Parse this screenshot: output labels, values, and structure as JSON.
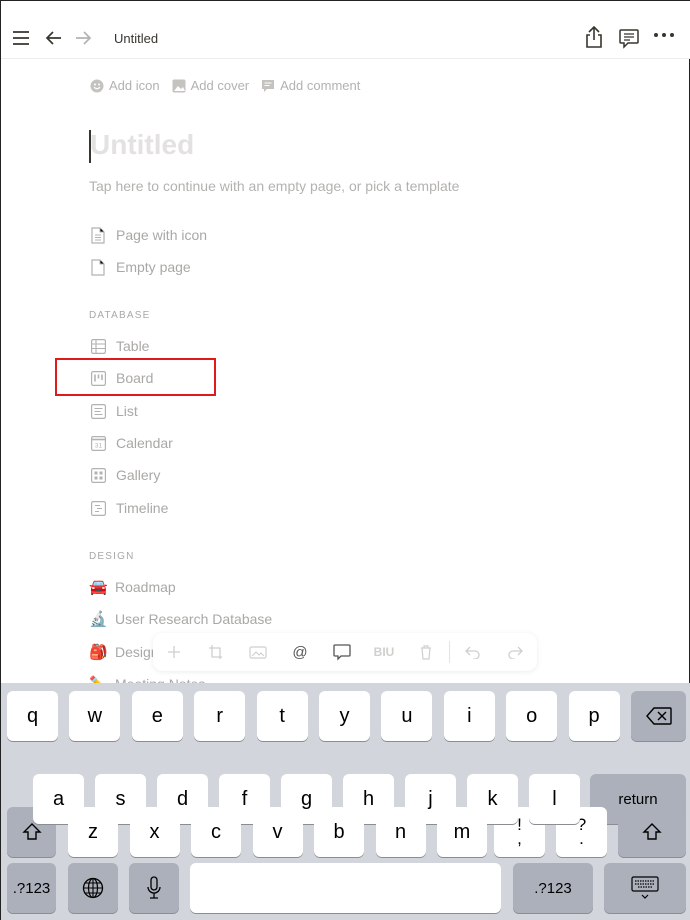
{
  "topbar": {
    "title": "Untitled",
    "icons": [
      "menu-icon",
      "back-arrow-icon",
      "forward-arrow-icon",
      "share-icon",
      "comments-icon",
      "more-icon"
    ]
  },
  "page_meta": {
    "add_icon": "Add icon",
    "add_cover": "Add cover",
    "add_comment": "Add comment"
  },
  "page": {
    "title_placeholder": "Untitled",
    "hint": "Tap here to continue with an empty page, or pick a template"
  },
  "templates": [
    {
      "label": "Page with icon",
      "icon": "page-text-icon"
    },
    {
      "label": "Empty page",
      "icon": "page-empty-icon"
    }
  ],
  "database": {
    "heading": "DATABASE",
    "items": [
      {
        "label": "Table",
        "icon": "table-icon"
      },
      {
        "label": "Board",
        "icon": "board-icon"
      },
      {
        "label": "List",
        "icon": "list-icon"
      },
      {
        "label": "Calendar",
        "icon": "calendar-icon",
        "icon_text": "31"
      },
      {
        "label": "Gallery",
        "icon": "gallery-icon"
      },
      {
        "label": "Timeline",
        "icon": "timeline-icon"
      }
    ]
  },
  "design": {
    "heading": "DESIGN",
    "items": [
      {
        "label": "Roadmap",
        "emoji": "🚘"
      },
      {
        "label": "User Research Database",
        "emoji": "🔬"
      },
      {
        "label": "Design System",
        "emoji": "🎒"
      },
      {
        "label": "Meeting Notes",
        "emoji": "✏️"
      }
    ]
  },
  "format_toolbar": {
    "mention": "@",
    "biu": "BIU"
  },
  "keyboard": {
    "row1": [
      "q",
      "w",
      "e",
      "r",
      "t",
      "y",
      "u",
      "i",
      "o",
      "p"
    ],
    "row2": [
      "a",
      "s",
      "d",
      "f",
      "g",
      "h",
      "j",
      "k",
      "l"
    ],
    "row3": [
      "z",
      "x",
      "c",
      "v",
      "b",
      "n",
      "m"
    ],
    "punct1_top": "!",
    "punct1_bottom": ",",
    "punct2_top": "?",
    "punct2_bottom": ".",
    "return": "return",
    "numbers": ".?123"
  }
}
